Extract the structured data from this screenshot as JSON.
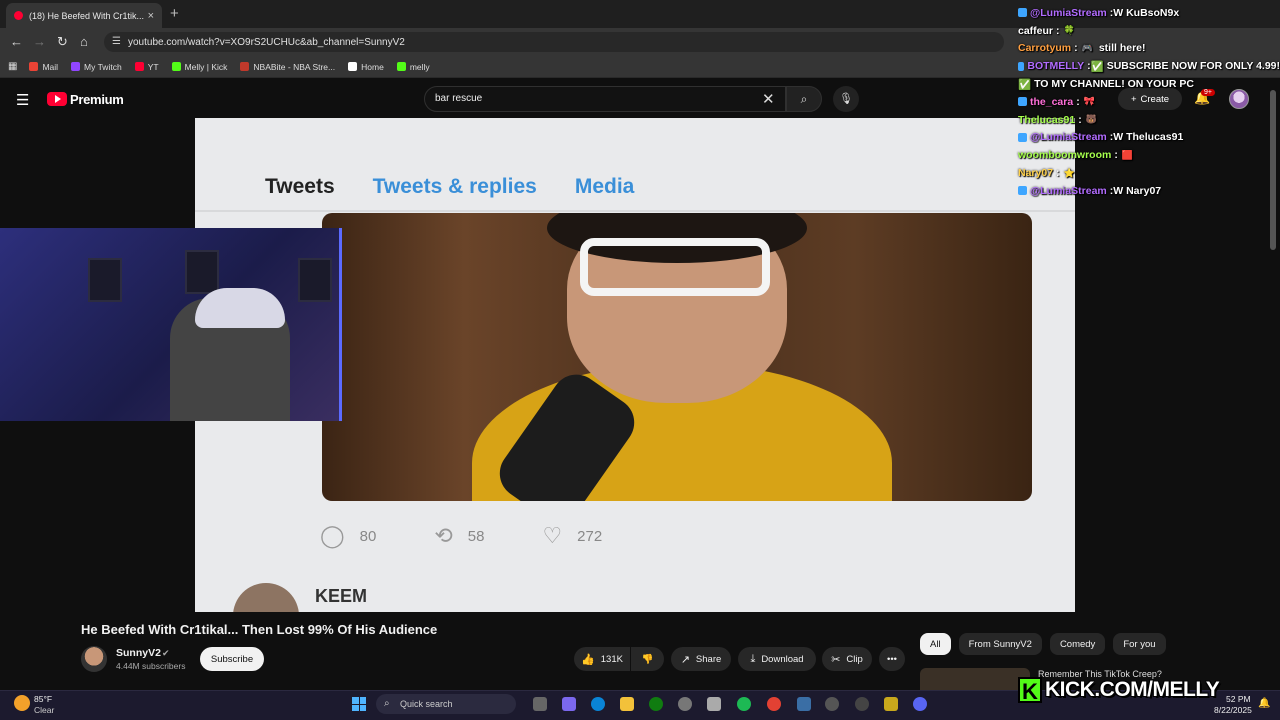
{
  "browser": {
    "tab_title": "(18) He Beefed With Cr1tik...",
    "tab_close": "×",
    "new_tab": "+",
    "url": "youtube.com/watch?v=XO9rS2UCHUc&ab_channel=SunnyV2",
    "bookmarks": [
      {
        "label": "Mail",
        "color": "#ea4335"
      },
      {
        "label": "My Twitch",
        "color": "#9146ff"
      },
      {
        "label": "YT",
        "color": "#ff0033"
      },
      {
        "label": "Melly | Kick",
        "color": "#53fc18"
      },
      {
        "label": "NBABite - NBA Stre...",
        "color": "#c0392b"
      },
      {
        "label": "Home",
        "color": "#ffffff"
      },
      {
        "label": "melly",
        "color": "#53fc18"
      }
    ]
  },
  "youtube": {
    "brand": "Premium",
    "search_value": "bar rescue",
    "create_label": "Create",
    "notif_badge": "9+"
  },
  "video": {
    "tweet_tabs": [
      "Tweets",
      "Tweets & replies",
      "Media"
    ],
    "tweet_counts": {
      "replies": "80",
      "retweets": "58",
      "likes": "272"
    },
    "next_tweet_name": "KEEM"
  },
  "watch": {
    "title": "He Beefed With Cr1tikal... Then Lost 99% Of His Audience",
    "channel_name": "SunnyV2",
    "subscribers": "4.44M subscribers",
    "subscribe_label": "Subscribe",
    "likes": "131K",
    "share_label": "Share",
    "download_label": "Download",
    "clip_label": "Clip",
    "more_label": "•••",
    "chips": [
      "All",
      "From SunnyV2",
      "Comedy",
      "For you"
    ],
    "reco_title": "Remember This TikTok Creep?"
  },
  "chat": [
    {
      "user": "@LumiaStream",
      "color": "#b26cff",
      "msg": "W KuBsoN9x",
      "badge": true
    },
    {
      "user": "caffeur",
      "color": "#ffffff",
      "msg": "",
      "badge": false
    },
    {
      "user": "Carrotyum",
      "color": "#ff9f40",
      "msg": "still here!",
      "badge": false
    },
    {
      "user": "BOTMELLY",
      "color": "#b26cff",
      "msg": "SUBSCRIBE NOW FOR ONLY 4.99!",
      "badge": true
    },
    {
      "user": "",
      "color": "#ffffff",
      "msg": "TO MY CHANNEL! ON YOUR PC",
      "badge": false
    },
    {
      "user": "the_cara",
      "color": "#ff6fd8",
      "msg": "",
      "badge": true
    },
    {
      "user": "Thelucas91",
      "color": "#a6ff4d",
      "msg": "",
      "badge": false
    },
    {
      "user": "@LumiaStream",
      "color": "#b26cff",
      "msg": "W Thelucas91",
      "badge": true
    },
    {
      "user": "woomboomwroom",
      "color": "#a6ff4d",
      "msg": "",
      "badge": false
    },
    {
      "user": "Nary07",
      "color": "#ffd24d",
      "msg": "",
      "badge": false
    },
    {
      "user": "@LumiaStream",
      "color": "#b26cff",
      "msg": "W Nary07",
      "badge": true
    }
  ],
  "overlay": {
    "kick_k": "K",
    "kick_text": "KICK.COM/MELLY"
  },
  "taskbar": {
    "temp": "85°F",
    "condition": "Clear",
    "search_label": "Quick search",
    "time": "52 PM",
    "date": "8/22/2025"
  },
  "colors": {
    "yt_red": "#ff0033",
    "kick_green": "#53fc18",
    "twitter_blue": "#3a8fd8"
  }
}
